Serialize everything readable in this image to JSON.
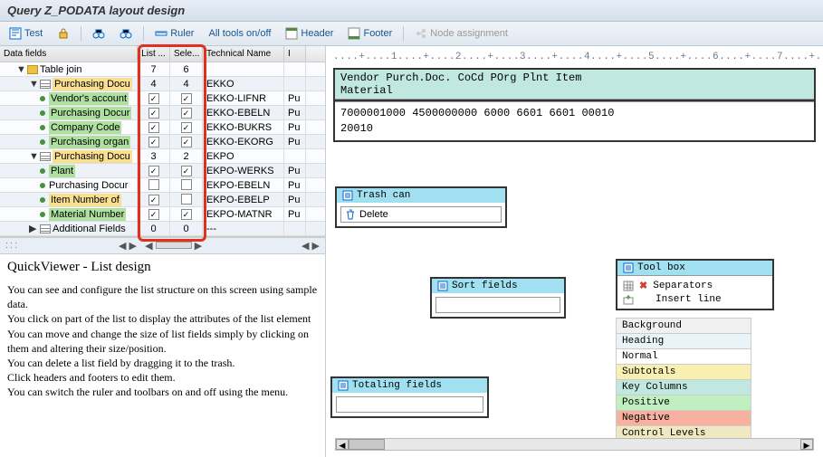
{
  "title": "Query Z_PODATA layout design",
  "toolbar": {
    "test": "Test",
    "ruler": "Ruler",
    "alltools": "All tools on/off",
    "header": "Header",
    "footer": "Footer",
    "node": "Node assignment"
  },
  "tree": {
    "headers": {
      "name": "Data fields",
      "list": "List ...",
      "sele": "Sele...",
      "tech": "Technical Name",
      "i": "I"
    },
    "rows": [
      {
        "level": 1,
        "icon": "folder",
        "expand": "▼",
        "label": "Table join",
        "list": "7",
        "sele": "6",
        "tech": "",
        "i": "",
        "alt": false
      },
      {
        "level": 2,
        "icon": "table",
        "expand": "▼",
        "label": "Purchasing Docu",
        "list": "4",
        "sele": "4",
        "tech": "EKKO",
        "i": "",
        "alt": true,
        "hl": "yellow"
      },
      {
        "level": 3,
        "icon": "dot",
        "label": "Vendor's account",
        "list": "chk",
        "sele": "chk",
        "tech": "EKKO-LIFNR",
        "i": "Pu",
        "alt": false,
        "hl": "green"
      },
      {
        "level": 3,
        "icon": "dot",
        "label": "Purchasing Docur",
        "list": "chk",
        "sele": "chk",
        "tech": "EKKO-EBELN",
        "i": "Pu",
        "alt": true,
        "hl": "green"
      },
      {
        "level": 3,
        "icon": "dot",
        "label": "Company Code",
        "list": "chk",
        "sele": "chk",
        "tech": "EKKO-BUKRS",
        "i": "Pu",
        "alt": false,
        "hl": "green"
      },
      {
        "level": 3,
        "icon": "dot",
        "label": "Purchasing organ",
        "list": "chk",
        "sele": "chk",
        "tech": "EKKO-EKORG",
        "i": "Pu",
        "alt": true,
        "hl": "green"
      },
      {
        "level": 2,
        "icon": "table",
        "expand": "▼",
        "label": "Purchasing Docu",
        "list": "3",
        "sele": "2",
        "tech": "EKPO",
        "i": "",
        "alt": false,
        "hl": "yellow"
      },
      {
        "level": 3,
        "icon": "dot",
        "label": "Plant",
        "list": "chk",
        "sele": "chk",
        "tech": "EKPO-WERKS",
        "i": "Pu",
        "alt": true,
        "hl": "green"
      },
      {
        "level": 3,
        "icon": "dot",
        "label": "Purchasing Docur",
        "list": "unchk",
        "sele": "unchk",
        "tech": "EKPO-EBELN",
        "i": "Pu",
        "alt": false
      },
      {
        "level": 3,
        "icon": "dot",
        "label": "Item Number of",
        "list": "chk",
        "sele": "unchk",
        "tech": "EKPO-EBELP",
        "i": "Pu",
        "alt": true,
        "hl": "yellow"
      },
      {
        "level": 3,
        "icon": "dot",
        "label": "Material Number",
        "list": "chk",
        "sele": "chk",
        "tech": "EKPO-MATNR",
        "i": "Pu",
        "alt": false,
        "hl": "green"
      },
      {
        "level": 2,
        "icon": "table",
        "expand": "▶",
        "label": "Additional Fields",
        "list": "0",
        "sele": "0",
        "tech": "---",
        "i": "",
        "alt": true
      }
    ]
  },
  "help": {
    "title": "QuickViewer - List design",
    "p1": "You can see and configure the list structure on this screen using sample data.",
    "p2": "You click on part of the list to display the attributes of the list element",
    "p3": "You can move and change the size of list fields simply by clicking on them and altering their size/position.",
    "p4": "You can delete a list field by dragging it to the trash.",
    "p5": "Click headers and footers to edit them.",
    "p6": "You can switch the ruler and toolbars on and off using the menu."
  },
  "ruler_text": "....+....1....+....2....+....3....+....4....+....5....+....6....+....7....+....8.",
  "preview": {
    "header1": "Vendor    Purch.Doc. CoCd POrg Plnt Item",
    "header2": "Material",
    "row1": "7000001000 4500000000 6000 6601 6601 00010",
    "row2": "20010"
  },
  "trash": {
    "title": "Trash can",
    "item": "Delete"
  },
  "sort": {
    "title": "Sort fields"
  },
  "total": {
    "title": "Totaling fields"
  },
  "toolbox": {
    "title": "Tool box",
    "separators": "Separators",
    "insert": "Insert line"
  },
  "legend": {
    "background": "Background",
    "heading": "Heading",
    "normal": "Normal",
    "subtotals": "Subtotals",
    "keycols": "Key Columns",
    "positive": "Positive",
    "negative": "Negative",
    "control": "Control Levels"
  }
}
